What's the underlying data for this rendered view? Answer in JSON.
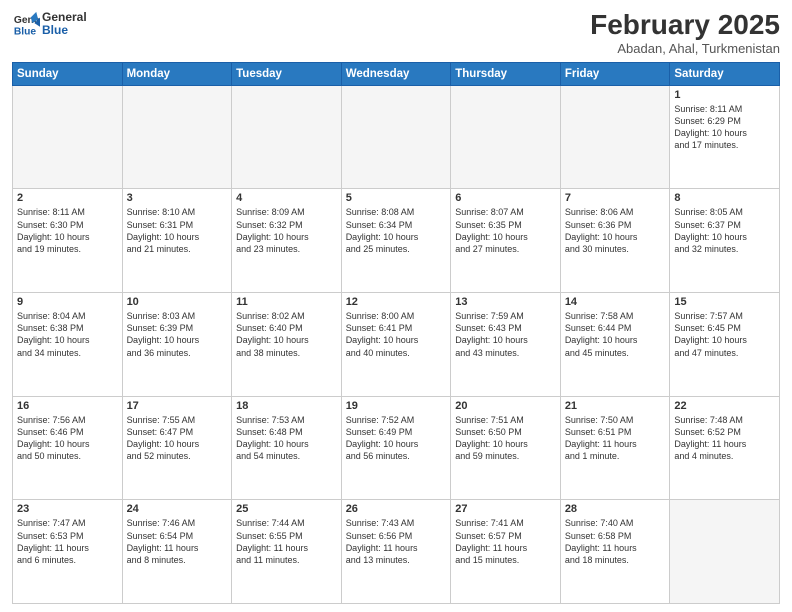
{
  "header": {
    "logo_line1": "General",
    "logo_line2": "Blue",
    "month_title": "February 2025",
    "subtitle": "Abadan, Ahal, Turkmenistan"
  },
  "days_of_week": [
    "Sunday",
    "Monday",
    "Tuesday",
    "Wednesday",
    "Thursday",
    "Friday",
    "Saturday"
  ],
  "weeks": [
    [
      {
        "day": "",
        "info": ""
      },
      {
        "day": "",
        "info": ""
      },
      {
        "day": "",
        "info": ""
      },
      {
        "day": "",
        "info": ""
      },
      {
        "day": "",
        "info": ""
      },
      {
        "day": "",
        "info": ""
      },
      {
        "day": "1",
        "info": "Sunrise: 8:11 AM\nSunset: 6:29 PM\nDaylight: 10 hours\nand 17 minutes."
      }
    ],
    [
      {
        "day": "2",
        "info": "Sunrise: 8:11 AM\nSunset: 6:30 PM\nDaylight: 10 hours\nand 19 minutes."
      },
      {
        "day": "3",
        "info": "Sunrise: 8:10 AM\nSunset: 6:31 PM\nDaylight: 10 hours\nand 21 minutes."
      },
      {
        "day": "4",
        "info": "Sunrise: 8:09 AM\nSunset: 6:32 PM\nDaylight: 10 hours\nand 23 minutes."
      },
      {
        "day": "5",
        "info": "Sunrise: 8:08 AM\nSunset: 6:34 PM\nDaylight: 10 hours\nand 25 minutes."
      },
      {
        "day": "6",
        "info": "Sunrise: 8:07 AM\nSunset: 6:35 PM\nDaylight: 10 hours\nand 27 minutes."
      },
      {
        "day": "7",
        "info": "Sunrise: 8:06 AM\nSunset: 6:36 PM\nDaylight: 10 hours\nand 30 minutes."
      },
      {
        "day": "8",
        "info": "Sunrise: 8:05 AM\nSunset: 6:37 PM\nDaylight: 10 hours\nand 32 minutes."
      }
    ],
    [
      {
        "day": "9",
        "info": "Sunrise: 8:04 AM\nSunset: 6:38 PM\nDaylight: 10 hours\nand 34 minutes."
      },
      {
        "day": "10",
        "info": "Sunrise: 8:03 AM\nSunset: 6:39 PM\nDaylight: 10 hours\nand 36 minutes."
      },
      {
        "day": "11",
        "info": "Sunrise: 8:02 AM\nSunset: 6:40 PM\nDaylight: 10 hours\nand 38 minutes."
      },
      {
        "day": "12",
        "info": "Sunrise: 8:00 AM\nSunset: 6:41 PM\nDaylight: 10 hours\nand 40 minutes."
      },
      {
        "day": "13",
        "info": "Sunrise: 7:59 AM\nSunset: 6:43 PM\nDaylight: 10 hours\nand 43 minutes."
      },
      {
        "day": "14",
        "info": "Sunrise: 7:58 AM\nSunset: 6:44 PM\nDaylight: 10 hours\nand 45 minutes."
      },
      {
        "day": "15",
        "info": "Sunrise: 7:57 AM\nSunset: 6:45 PM\nDaylight: 10 hours\nand 47 minutes."
      }
    ],
    [
      {
        "day": "16",
        "info": "Sunrise: 7:56 AM\nSunset: 6:46 PM\nDaylight: 10 hours\nand 50 minutes."
      },
      {
        "day": "17",
        "info": "Sunrise: 7:55 AM\nSunset: 6:47 PM\nDaylight: 10 hours\nand 52 minutes."
      },
      {
        "day": "18",
        "info": "Sunrise: 7:53 AM\nSunset: 6:48 PM\nDaylight: 10 hours\nand 54 minutes."
      },
      {
        "day": "19",
        "info": "Sunrise: 7:52 AM\nSunset: 6:49 PM\nDaylight: 10 hours\nand 56 minutes."
      },
      {
        "day": "20",
        "info": "Sunrise: 7:51 AM\nSunset: 6:50 PM\nDaylight: 10 hours\nand 59 minutes."
      },
      {
        "day": "21",
        "info": "Sunrise: 7:50 AM\nSunset: 6:51 PM\nDaylight: 11 hours\nand 1 minute."
      },
      {
        "day": "22",
        "info": "Sunrise: 7:48 AM\nSunset: 6:52 PM\nDaylight: 11 hours\nand 4 minutes."
      }
    ],
    [
      {
        "day": "23",
        "info": "Sunrise: 7:47 AM\nSunset: 6:53 PM\nDaylight: 11 hours\nand 6 minutes."
      },
      {
        "day": "24",
        "info": "Sunrise: 7:46 AM\nSunset: 6:54 PM\nDaylight: 11 hours\nand 8 minutes."
      },
      {
        "day": "25",
        "info": "Sunrise: 7:44 AM\nSunset: 6:55 PM\nDaylight: 11 hours\nand 11 minutes."
      },
      {
        "day": "26",
        "info": "Sunrise: 7:43 AM\nSunset: 6:56 PM\nDaylight: 11 hours\nand 13 minutes."
      },
      {
        "day": "27",
        "info": "Sunrise: 7:41 AM\nSunset: 6:57 PM\nDaylight: 11 hours\nand 15 minutes."
      },
      {
        "day": "28",
        "info": "Sunrise: 7:40 AM\nSunset: 6:58 PM\nDaylight: 11 hours\nand 18 minutes."
      },
      {
        "day": "",
        "info": ""
      }
    ]
  ]
}
